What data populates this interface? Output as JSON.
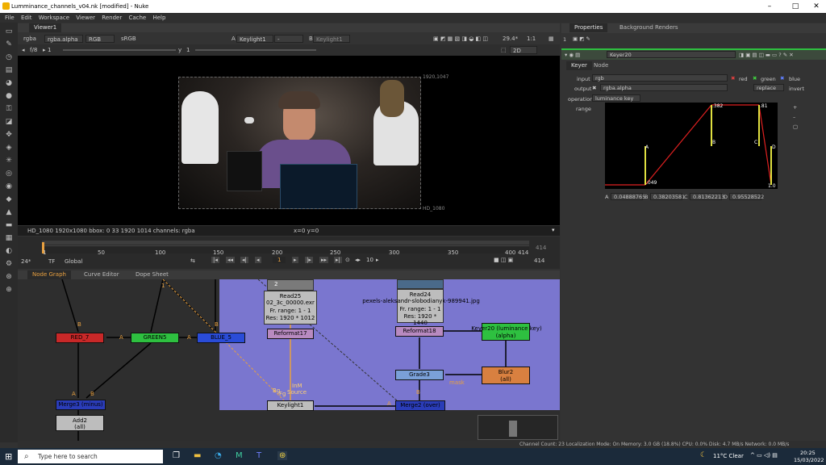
{
  "window": {
    "title": "Lumminance_channels_v04.nk [modified] - Nuke"
  },
  "menu": [
    "File",
    "Edit",
    "Workspace",
    "Viewer",
    "Render",
    "Cache",
    "Help"
  ],
  "viewer": {
    "tab": "Viewer1",
    "channels": "rgba",
    "layer": "rgba.alpha",
    "colorspace_a": "RGB",
    "lut": "sRGB",
    "input_a_label": "A",
    "input_a": "Keylight1",
    "input_a_op": "-",
    "input_b_label": "B",
    "input_b": "Keylight1",
    "zoom": "29.4*",
    "ratio": "1:1",
    "fstop": "f/8",
    "frame_step": "1",
    "y_label": "y",
    "y_value": "1",
    "mode": "2D",
    "format_top": "1920,1047",
    "format_name": "HD_1080",
    "info_left": "HD_1080 1920x1080  bbox: 0 33 1920 1014 channels: rgba",
    "info_mid": "x=0 y=0"
  },
  "timeline": {
    "ticks": [
      "1",
      "50",
      "100",
      "150",
      "200",
      "250",
      "300",
      "350",
      "400",
      "414"
    ],
    "end_top": "414",
    "fps": "24*",
    "tf": "TF",
    "scope": "Global",
    "current_frame": "1",
    "increment": "10",
    "end_frame": "414"
  },
  "panels": {
    "node_graph": "Node Graph",
    "curve_editor": "Curve Editor",
    "dope_sheet": "Dope Sheet"
  },
  "nodes": {
    "red": "RED_7",
    "green": "GREEN5",
    "blue": "BLUE_5",
    "merge3": "Merge3 (minus)",
    "add2_title": "Add2",
    "add2_sub": "(all)",
    "read25_title": "Read25",
    "read25_file": "02_3c_00000.exr",
    "read25_range": "Fr. range: 1 - 1",
    "read25_res": "Res: 1920 * 1012",
    "reformat17": "Reformat17",
    "keylight1": "Keylight1",
    "read24_title": "Read24",
    "read24_file": "pexels-aleksandr-slobodianyk-989941.jpg",
    "read24_range": "Fr. range: 1 - 1",
    "read24_res": "Res: 1920 * 1440",
    "reformat18": "Reformat18",
    "grade3": "Grade3",
    "merge2": "Merge2 (over)",
    "keyer20_title": "Keyer20 (luminance key)",
    "keyer20_sub": "(alpha)",
    "blur2_title": "Blur2",
    "blur2_sub": "(all)",
    "pin_b": "B",
    "pin_a": "A",
    "pin_bg": "Bg",
    "pin_fg": "Fg",
    "pin_ignm": "InM",
    "pin_source": "Source",
    "pin_mask": "mask",
    "pin_2": "2"
  },
  "properties": {
    "tab_properties": "Properties",
    "tab_background": "Background Renders",
    "node_count": "1",
    "node_name": "Keyer20",
    "subtab_keyer": "Keyer",
    "subtab_node": "Node",
    "input_label": "input",
    "input_value": "rgb",
    "chk_red": "red",
    "chk_green": "green",
    "chk_blue": "blue",
    "output_label": "output",
    "output_value": "rgba.alpha",
    "output_mode": "replace",
    "invert": "invert",
    "operation_label": "operation",
    "operation_value": "luminance key",
    "range_label": "range",
    "curve_labels": {
      "a": "A",
      "b": "B",
      "c": "C",
      "d": "D",
      "v049": ".049",
      "v382": ".382",
      "v81": ".81",
      "v1": "1.0"
    },
    "values": {
      "a_label": "A",
      "a": "0.04888765",
      "b_label": "B",
      "b": "0.38203581",
      "c_label": "C",
      "c": "0.81362213",
      "d_label": "D",
      "d": "0.95528522"
    }
  },
  "status": "Channel Count: 23  Localization Mode: On  Memory: 3.0 GB (18.8%)  CPU: 0.0%  Disk: 4.7 MB/s  Network: 0.0 MB/s",
  "taskbar": {
    "search_placeholder": "Type here to search",
    "weather": "11°C  Clear",
    "time": "20:25",
    "date": "15/03/2022"
  }
}
